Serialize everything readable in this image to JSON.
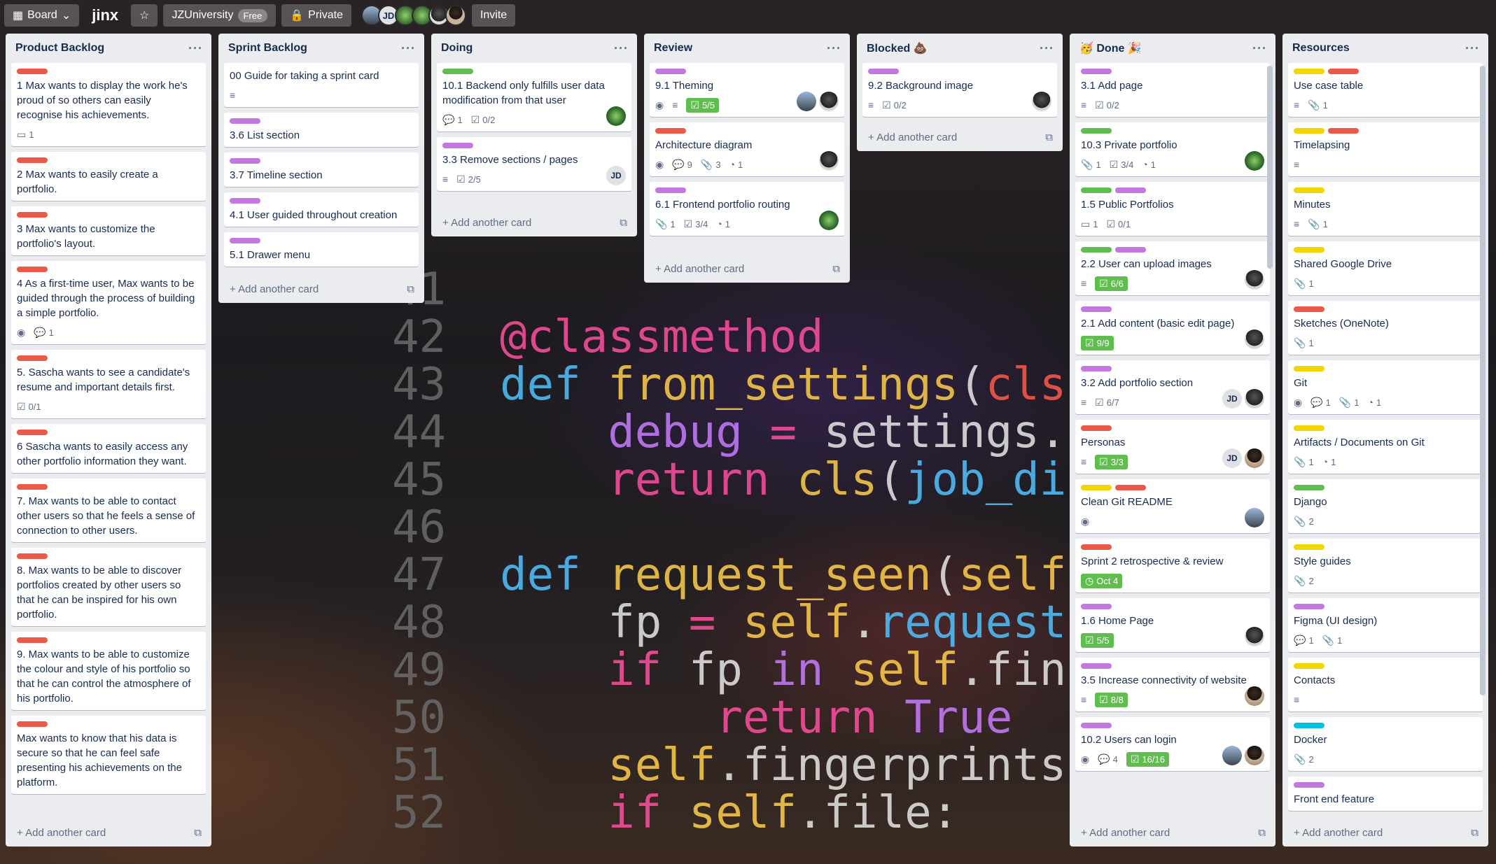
{
  "colors": {
    "red": "#eb5a46",
    "purple": "#c377e0",
    "green": "#61bd4f",
    "yellow": "#f2d600",
    "sky": "#00c2e0",
    "orange": "#ff9f1a"
  },
  "topbar": {
    "board_label": "Board",
    "title": "jinx",
    "team": "JZUniversity",
    "team_plan": "Free",
    "visibility": "Private",
    "member_initials": "JD",
    "invite": "Invite"
  },
  "common": {
    "add_card": "Add another card",
    "menu": "···"
  },
  "lists": [
    {
      "title": "Product Backlog",
      "cards": [
        {
          "labels": [
            "red"
          ],
          "title": "1 Max wants to display the work he's proud of so others can easily recognise his achievements.",
          "badges": [
            {
              "icon": "card-icon",
              "text": "1"
            }
          ]
        },
        {
          "labels": [
            "red"
          ],
          "title": "2 Max wants to easily create a portfolio.",
          "badges": []
        },
        {
          "labels": [
            "red"
          ],
          "title": "3 Max wants to customize the portfolio's layout.",
          "badges": []
        },
        {
          "labels": [
            "red"
          ],
          "title": "4 As a first-time user, Max wants to be guided through the process of building a simple portfolio.",
          "badges": [
            {
              "icon": "eye-icon",
              "text": ""
            },
            {
              "icon": "comment-icon",
              "text": "1"
            }
          ]
        },
        {
          "labels": [
            "red"
          ],
          "title": "5. Sascha wants to see a candidate's resume and important details first.",
          "badges": [
            {
              "icon": "checklist-icon",
              "text": "0/1"
            }
          ]
        },
        {
          "labels": [
            "red"
          ],
          "title": "6 Sascha wants to easily access any other portfolio information they want.",
          "badges": []
        },
        {
          "labels": [
            "red"
          ],
          "title": "7. Max wants to be able to contact other users so that he feels a sense of connection to other users.",
          "badges": []
        },
        {
          "labels": [
            "red"
          ],
          "title": "8. Max wants to be able to discover portfolios created by other users so that he can be inspired for his own portfolio.",
          "badges": []
        },
        {
          "labels": [
            "red"
          ],
          "title": "9. Max wants to be able to customize the colour and style of his portfolio so that he can control the atmosphere of his portfolio.",
          "badges": []
        },
        {
          "labels": [
            "red"
          ],
          "title": "Max wants to know that his data is secure so that he can feel safe presenting his achievements on the platform.",
          "badges": []
        }
      ]
    },
    {
      "title": "Sprint Backlog",
      "cards": [
        {
          "labels": [],
          "title": "00 Guide for taking a sprint card",
          "badges": [
            {
              "icon": "description-icon",
              "text": ""
            }
          ]
        },
        {
          "labels": [
            "purple"
          ],
          "title": "3.6 List section",
          "badges": []
        },
        {
          "labels": [
            "purple"
          ],
          "title": "3.7 Timeline section",
          "badges": []
        },
        {
          "labels": [
            "purple"
          ],
          "title": "4.1 User guided throughout creation",
          "badges": []
        },
        {
          "labels": [
            "purple"
          ],
          "title": "5.1 Drawer menu",
          "badges": []
        }
      ]
    },
    {
      "title": "Doing",
      "cards": [
        {
          "labels": [
            "green"
          ],
          "title": "10.1 Backend only fulfills user data modification from that user",
          "badges": [
            {
              "icon": "comment-icon",
              "text": "1"
            },
            {
              "icon": "checklist-icon",
              "text": "0/2"
            }
          ],
          "members": [
            "g"
          ]
        },
        {
          "labels": [
            "purple"
          ],
          "title": "3.3 Remove sections / pages",
          "badges": [
            {
              "icon": "description-icon",
              "text": ""
            },
            {
              "icon": "checklist-icon",
              "text": "2/5"
            }
          ],
          "members": [
            "JD"
          ]
        }
      ]
    },
    {
      "title": "Review",
      "cards": [
        {
          "labels": [
            "purple"
          ],
          "title": "9.1 Theming",
          "badges": [
            {
              "icon": "eye-icon",
              "text": ""
            },
            {
              "icon": "description-icon",
              "text": ""
            },
            {
              "icon": "checklist-icon",
              "text": "5/5",
              "done": true
            }
          ],
          "members": [
            "l",
            "p"
          ]
        },
        {
          "labels": [
            "red"
          ],
          "title": "Architecture diagram",
          "badges": [
            {
              "icon": "eye-icon",
              "text": ""
            },
            {
              "icon": "comment-icon",
              "text": "9"
            },
            {
              "icon": "attachment-icon",
              "text": "3"
            },
            {
              "icon": "github-icon",
              "text": "1"
            }
          ],
          "members": [
            "p"
          ]
        },
        {
          "labels": [
            "purple"
          ],
          "title": "6.1 Frontend portfolio routing",
          "badges": [
            {
              "icon": "attachment-icon",
              "text": "1"
            },
            {
              "icon": "checklist-icon",
              "text": "3/4"
            },
            {
              "icon": "github-icon",
              "text": "1"
            }
          ],
          "members": [
            "g"
          ]
        }
      ]
    },
    {
      "title": "Blocked 💩",
      "cards": [
        {
          "labels": [
            "purple"
          ],
          "title": "9.2 Background image",
          "badges": [
            {
              "icon": "description-icon",
              "text": ""
            },
            {
              "icon": "checklist-icon",
              "text": "0/2"
            }
          ],
          "members": [
            "p"
          ]
        }
      ]
    },
    {
      "title": "🥳 Done 🎉",
      "cards": [
        {
          "labels": [
            "purple"
          ],
          "title": "3.1 Add page",
          "badges": [
            {
              "icon": "description-icon",
              "text": ""
            },
            {
              "icon": "checklist-icon",
              "text": "0/2"
            }
          ]
        },
        {
          "labels": [
            "green"
          ],
          "title": "10.3 Private portfolio",
          "badges": [
            {
              "icon": "attachment-icon",
              "text": "1"
            },
            {
              "icon": "checklist-icon",
              "text": "3/4"
            },
            {
              "icon": "github-icon",
              "text": "1"
            }
          ],
          "members": [
            "g"
          ]
        },
        {
          "labels": [
            "green",
            "purple"
          ],
          "title": "1.5 Public Portfolios",
          "badges": [
            {
              "icon": "card-icon",
              "text": "1"
            },
            {
              "icon": "checklist-icon",
              "text": "0/1"
            }
          ]
        },
        {
          "labels": [
            "green",
            "purple"
          ],
          "title": "2.2 User can upload images",
          "badges": [
            {
              "icon": "description-icon",
              "text": ""
            },
            {
              "icon": "checklist-icon",
              "text": "6/6",
              "done": true
            }
          ],
          "members": [
            "p"
          ]
        },
        {
          "labels": [
            "purple"
          ],
          "title": "2.1 Add content (basic edit page)",
          "badges": [
            {
              "icon": "checklist-icon",
              "text": "9/9",
              "done": true
            }
          ],
          "members": [
            "p"
          ]
        },
        {
          "labels": [
            "purple"
          ],
          "title": "3.2 Add portfolio section",
          "badges": [
            {
              "icon": "description-icon",
              "text": ""
            },
            {
              "icon": "checklist-icon",
              "text": "6/7"
            }
          ],
          "members": [
            "JD",
            "p"
          ]
        },
        {
          "labels": [
            "red"
          ],
          "title": "Personas",
          "badges": [
            {
              "icon": "description-icon",
              "text": ""
            },
            {
              "icon": "checklist-icon",
              "text": "3/3",
              "done": true
            }
          ],
          "members": [
            "JD",
            "m"
          ]
        },
        {
          "labels": [
            "yellow",
            "red"
          ],
          "title": "Clean Git README",
          "badges": [
            {
              "icon": "eye-icon",
              "text": ""
            }
          ],
          "members": [
            "l"
          ]
        },
        {
          "labels": [
            "red"
          ],
          "title": "Sprint 2 retrospective & review",
          "badges": [
            {
              "icon": "clock-icon",
              "text": "Oct 4",
              "done": true
            }
          ]
        },
        {
          "labels": [
            "purple"
          ],
          "title": "1.6 Home Page",
          "badges": [
            {
              "icon": "checklist-icon",
              "text": "5/5",
              "done": true
            }
          ],
          "members": [
            "p"
          ]
        },
        {
          "labels": [
            "purple"
          ],
          "title": "3.5 Increase connectivity of website",
          "badges": [
            {
              "icon": "description-icon",
              "text": ""
            },
            {
              "icon": "checklist-icon",
              "text": "8/8",
              "done": true
            }
          ],
          "members": [
            "m"
          ]
        },
        {
          "labels": [
            "purple"
          ],
          "title": "10.2 Users can login",
          "badges": [
            {
              "icon": "eye-icon",
              "text": ""
            },
            {
              "icon": "comment-icon",
              "text": "4"
            },
            {
              "icon": "checklist-icon",
              "text": "16/16",
              "done": true
            }
          ],
          "members": [
            "l",
            "m"
          ]
        }
      ]
    },
    {
      "title": "Resources",
      "cards": [
        {
          "labels": [
            "yellow",
            "red"
          ],
          "title": "Use case table",
          "badges": [
            {
              "icon": "description-icon",
              "text": ""
            },
            {
              "icon": "attachment-icon",
              "text": "1"
            }
          ]
        },
        {
          "labels": [
            "yellow",
            "red"
          ],
          "title": "Timelapsing",
          "badges": [
            {
              "icon": "description-icon",
              "text": ""
            }
          ]
        },
        {
          "labels": [
            "yellow"
          ],
          "title": "Minutes",
          "badges": [
            {
              "icon": "description-icon",
              "text": ""
            },
            {
              "icon": "attachment-icon",
              "text": "1"
            }
          ]
        },
        {
          "labels": [
            "yellow"
          ],
          "title": "Shared Google Drive",
          "badges": [
            {
              "icon": "attachment-icon",
              "text": "1"
            }
          ]
        },
        {
          "labels": [
            "red"
          ],
          "title": "Sketches (OneNote)",
          "badges": [
            {
              "icon": "attachment-icon",
              "text": "1"
            }
          ]
        },
        {
          "labels": [
            "yellow"
          ],
          "title": "Git",
          "badges": [
            {
              "icon": "eye-icon",
              "text": ""
            },
            {
              "icon": "comment-icon",
              "text": "1"
            },
            {
              "icon": "attachment-icon",
              "text": "1"
            },
            {
              "icon": "github-icon",
              "text": "1"
            }
          ]
        },
        {
          "labels": [
            "yellow"
          ],
          "title": "Artifacts / Documents on Git",
          "badges": [
            {
              "icon": "attachment-icon",
              "text": "1"
            },
            {
              "icon": "github-icon",
              "text": "1"
            }
          ]
        },
        {
          "labels": [
            "green"
          ],
          "title": "Django",
          "badges": [
            {
              "icon": "attachment-icon",
              "text": "2"
            }
          ]
        },
        {
          "labels": [
            "yellow"
          ],
          "title": "Style guides",
          "badges": [
            {
              "icon": "attachment-icon",
              "text": "2"
            }
          ]
        },
        {
          "labels": [
            "purple"
          ],
          "title": "Figma (UI design)",
          "badges": [
            {
              "icon": "comment-icon",
              "text": "1"
            },
            {
              "icon": "attachment-icon",
              "text": "1"
            }
          ]
        },
        {
          "labels": [
            "yellow"
          ],
          "title": "Contacts",
          "badges": [
            {
              "icon": "description-icon",
              "text": ""
            }
          ]
        },
        {
          "labels": [
            "sky"
          ],
          "title": "Docker",
          "badges": [
            {
              "icon": "attachment-icon",
              "text": "2"
            }
          ]
        },
        {
          "labels": [
            "purple"
          ],
          "title": "Front end feature",
          "badges": []
        }
      ]
    }
  ]
}
